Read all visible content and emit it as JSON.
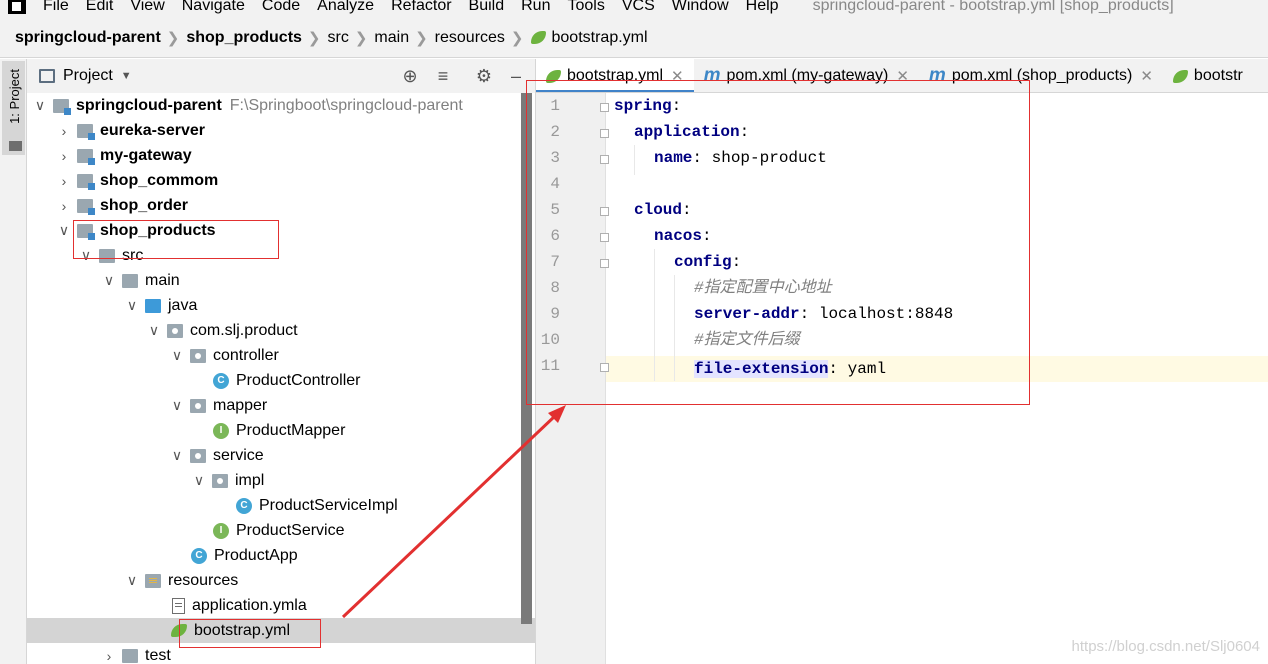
{
  "menu": {
    "items": [
      "File",
      "Edit",
      "View",
      "Navigate",
      "Code",
      "Analyze",
      "Refactor",
      "Build",
      "Run",
      "Tools",
      "VCS",
      "Window",
      "Help"
    ],
    "window_title": "springcloud-parent - bootstrap.yml [shop_products]"
  },
  "breadcrumb": [
    "springcloud-parent",
    "shop_products",
    "src",
    "main",
    "resources",
    "bootstrap.yml"
  ],
  "toolstrip": {
    "label": "1: Project"
  },
  "project_panel": {
    "title": "Project",
    "tree": [
      {
        "label": "springcloud-parent",
        "path": "F:\\Springboot\\springcloud-parent"
      },
      {
        "label": "eureka-server"
      },
      {
        "label": "my-gateway"
      },
      {
        "label": "shop_commom"
      },
      {
        "label": "shop_order"
      },
      {
        "label": "shop_products"
      },
      {
        "label": "src"
      },
      {
        "label": "main"
      },
      {
        "label": "java"
      },
      {
        "label": "com.slj.product"
      },
      {
        "label": "controller"
      },
      {
        "label": "ProductController"
      },
      {
        "label": "mapper"
      },
      {
        "label": "ProductMapper"
      },
      {
        "label": "service"
      },
      {
        "label": "impl"
      },
      {
        "label": "ProductServiceImpl"
      },
      {
        "label": "ProductService"
      },
      {
        "label": "ProductApp"
      },
      {
        "label": "resources"
      },
      {
        "label": "application.ymla"
      },
      {
        "label": "bootstrap.yml"
      },
      {
        "label": "test"
      }
    ]
  },
  "editor": {
    "tabs": [
      {
        "label": "bootstrap.yml"
      },
      {
        "label": "pom.xml (my-gateway)"
      },
      {
        "label": "pom.xml (shop_products)"
      },
      {
        "label": "bootstr"
      }
    ],
    "line_numbers": [
      "1",
      "2",
      "3",
      "4",
      "5",
      "6",
      "7",
      "8",
      "9",
      "10",
      "11"
    ],
    "code": [
      {
        "key": "spring",
        "sep": ":",
        "val": "",
        "comment": ""
      },
      {
        "key": "application",
        "sep": ":",
        "val": "",
        "comment": ""
      },
      {
        "key": "name",
        "sep": ":",
        "val": " shop-product",
        "comment": ""
      },
      {
        "key": "",
        "sep": "",
        "val": "",
        "comment": ""
      },
      {
        "key": "cloud",
        "sep": ":",
        "val": "",
        "comment": ""
      },
      {
        "key": "nacos",
        "sep": ":",
        "val": "",
        "comment": ""
      },
      {
        "key": "config",
        "sep": ":",
        "val": "",
        "comment": ""
      },
      {
        "key": "",
        "sep": "",
        "val": "",
        "comment": "#指定配置中心地址"
      },
      {
        "key": "server-addr",
        "sep": ":",
        "val": " localhost:8848",
        "comment": ""
      },
      {
        "key": "",
        "sep": "",
        "val": "",
        "comment": "#指定文件后缀"
      },
      {
        "key": "file-extension",
        "sep": ":",
        "val": " yaml",
        "comment": ""
      }
    ]
  },
  "watermark": "https://blog.csdn.net/Slj0604",
  "colors": {
    "annotation": "#e23030",
    "tab_active_underline": "#4083c9",
    "yaml_key": "#000080"
  }
}
